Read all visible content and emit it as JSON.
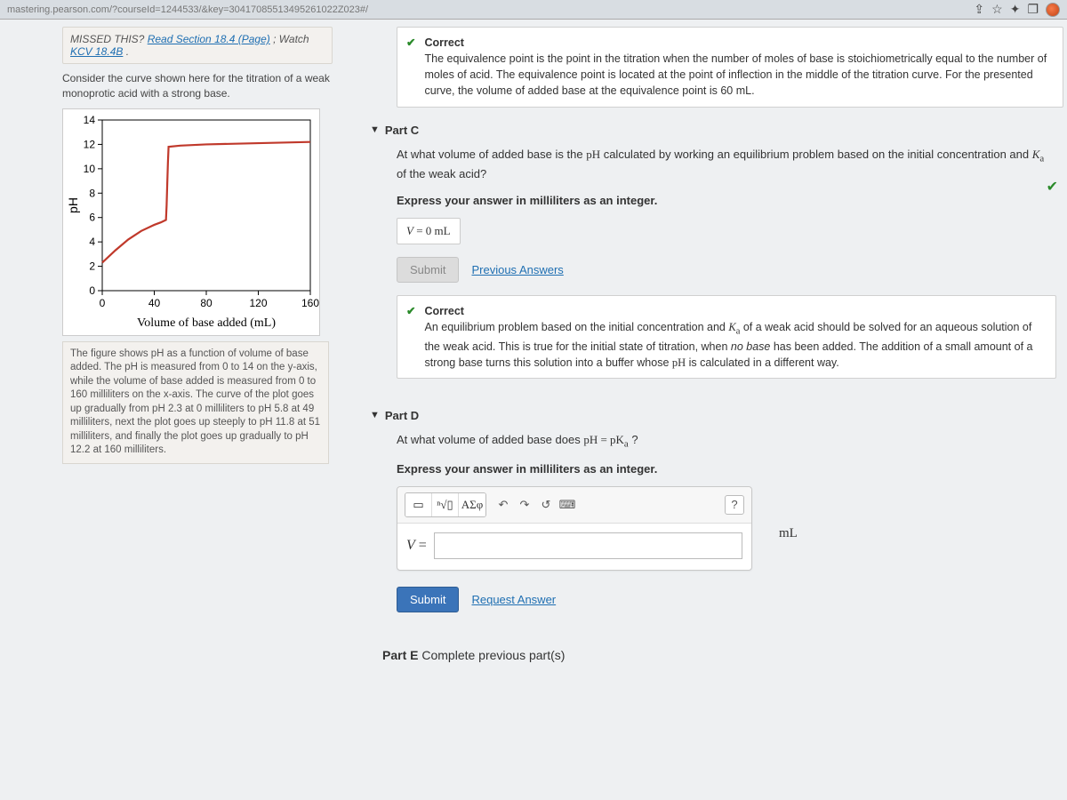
{
  "browser": {
    "url_fragment": "mastering.pearson.com/?courseId=1244533/&key=30417085513495261022Z023#/",
    "icons": {
      "share": "⇪",
      "star": "☆",
      "puzzle": "✦",
      "window": "❐"
    }
  },
  "left": {
    "missed_line1a": "MISSED THIS? ",
    "missed_line1b": "Read Section 18.4 (Page)",
    "missed_line1c": " ; Watch ",
    "missed_link2": "KCV 18.4B",
    "missed_dot": " .",
    "consider": "Consider the curve shown here for the titration of a weak monoprotic acid with a strong base.",
    "caption": "The figure shows pH as a function of volume of base added. The pH is measured from 0 to 14 on the y-axis, while the volume of base added is measured from 0 to 160 milliliters on the x-axis. The curve of the plot goes up gradually from pH 2.3 at 0 milliliters to pH 5.8 at 49 milliliters, next the plot goes up steeply to pH 11.8 at 51 milliliters, and finally the plot goes up gradually to pH 12.2 at 160 milliliters."
  },
  "chart_data": {
    "type": "line",
    "xlabel": "Volume of base added (mL)",
    "ylabel": "pH",
    "x": [
      0,
      49,
      51,
      160
    ],
    "values": [
      2.3,
      5.8,
      11.8,
      12.2
    ],
    "xlim": [
      0,
      160
    ],
    "ylim": [
      0,
      14
    ],
    "xticks": [
      0,
      40,
      80,
      120,
      160
    ],
    "yticks": [
      0,
      2,
      4,
      6,
      8,
      10,
      12,
      14
    ],
    "color": "#c0392b"
  },
  "feedback_top": {
    "title": "Correct",
    "body": "The equivalence point is the point in the titration when the number of moles of base is stoichiometrically equal to the number of moles of acid. The equivalence point is located at the point of inflection in the middle of the titration curve. For the presented curve, the volume of added base at the equivalence point is 60 mL."
  },
  "partC": {
    "title": "Part C",
    "q1": "At what volume of added base is the ",
    "q2": "pH",
    "q3": " calculated by working an equilibrium problem based on the initial concentration and ",
    "q4": "K",
    "q4sub": "a",
    "q5": " of the weak acid?",
    "instruct": "Express your answer in milliliters as an integer.",
    "answer_var": "V",
    "answer_eq": " = ",
    "answer_val": "0",
    "answer_unit": " mL",
    "submit": "Submit",
    "prev": "Previous Answers",
    "correct_title": "Correct",
    "correct_body1": "An equilibrium problem based on the initial concentration and ",
    "correct_body2": "K",
    "correct_body2sub": "a",
    "correct_body3": " of a weak acid should be solved for an aqueous solution of the weak acid. This is true for the initial state of titration, when ",
    "correct_body4": "no base",
    "correct_body5": " has been added. The addition of a small amount of a strong base turns this solution into a buffer whose ",
    "correct_body6": "pH",
    "correct_body7": " is calculated in a different way."
  },
  "partD": {
    "title": "Part D",
    "q1": "At what volume of added base does ",
    "q2": "pH = pK",
    "q2sub": "a",
    "q3": " ?",
    "instruct": "Express your answer in milliliters as an integer.",
    "greek_label": "ΑΣφ",
    "var": "V",
    "eq": " = ",
    "unit": "mL",
    "submit": "Submit",
    "request": "Request Answer",
    "help": "?"
  },
  "partE": {
    "label": "Part E",
    "sub": "  Complete previous part(s)"
  }
}
